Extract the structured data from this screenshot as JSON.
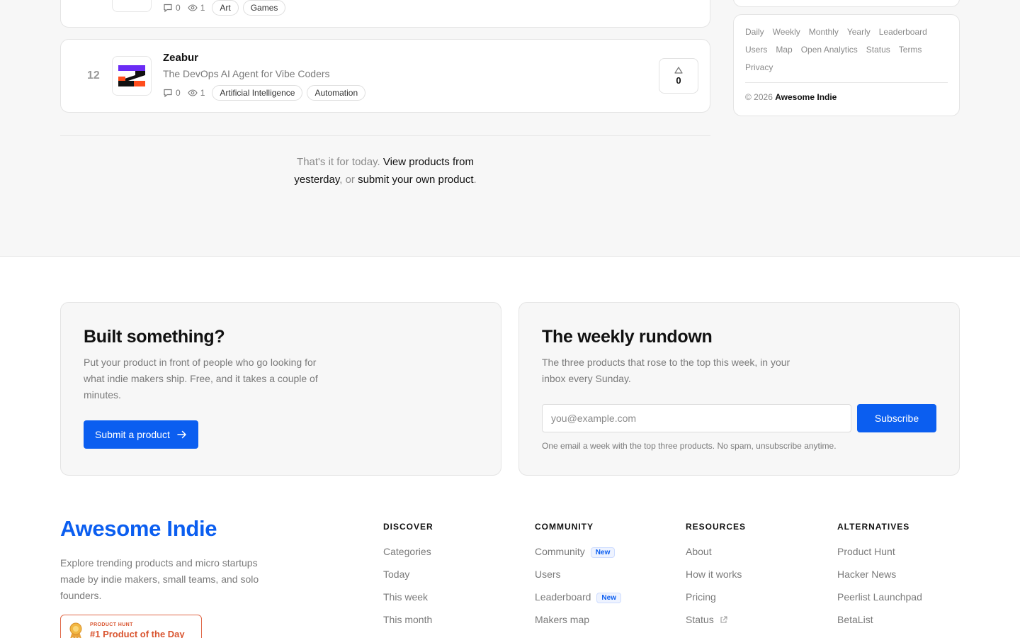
{
  "products": {
    "top": {
      "comments": "0",
      "views": "1",
      "tags": [
        "Art",
        "Games"
      ]
    },
    "main": {
      "rank": "12",
      "name": "Zeabur",
      "tagline": "The DevOps AI Agent for Vibe Coders",
      "comments": "0",
      "views": "1",
      "tags": [
        "Artificial Intelligence",
        "Automation"
      ],
      "votes": "0"
    }
  },
  "end_note": {
    "prefix": "That's it for today.",
    "link1_part1": "View products from",
    "link1_part2": "yesterday",
    "middle": ", or",
    "link2": "submit your own product",
    "suffix": "."
  },
  "sidebar": {
    "links": [
      "Daily",
      "Weekly",
      "Monthly",
      "Yearly",
      "Leaderboard",
      "Users",
      "Map",
      "Open Analytics",
      "Status",
      "Terms",
      "Privacy"
    ],
    "copyright_prefix": "© 2026",
    "copyright_brand": "Awesome Indie"
  },
  "promo_submit": {
    "title": "Built something?",
    "description": "Put your product in front of people who go looking for what indie makers ship. Free, and it takes a couple of minutes.",
    "button": "Submit a product"
  },
  "promo_newsletter": {
    "title": "The weekly rundown",
    "description": "The three products that rose to the top this week, in your inbox every Sunday.",
    "placeholder": "you@example.com",
    "button": "Subscribe",
    "fineprint": "One email a week with the top three products. No spam, unsubscribe anytime."
  },
  "footer": {
    "brand": "Awesome Indie",
    "description": "Explore trending products and micro startups made by indie makers, small teams, and solo founders.",
    "badge_small": "PRODUCT HUNT",
    "badge_big": "#1 Product of the Day",
    "columns": {
      "discover": {
        "title": "DISCOVER",
        "items": [
          "Categories",
          "Today",
          "This week",
          "This month"
        ]
      },
      "community": {
        "title": "COMMUNITY",
        "items": [
          "Community",
          "Users",
          "Leaderboard",
          "Makers map"
        ],
        "new_badge": "New"
      },
      "resources": {
        "title": "RESOURCES",
        "items": [
          "About",
          "How it works",
          "Pricing",
          "Status"
        ]
      },
      "alternatives": {
        "title": "ALTERNATIVES",
        "items": [
          "Product Hunt",
          "Hacker News",
          "Peerlist Launchpad",
          "BetaList"
        ]
      }
    }
  },
  "colors": {
    "accent": "#0b5ef0",
    "badge_orange": "#d9542f",
    "zeabur_purple": "#6b2cf5",
    "zeabur_orange": "#ff4d1c",
    "teal_logo": "#27a6c4"
  }
}
